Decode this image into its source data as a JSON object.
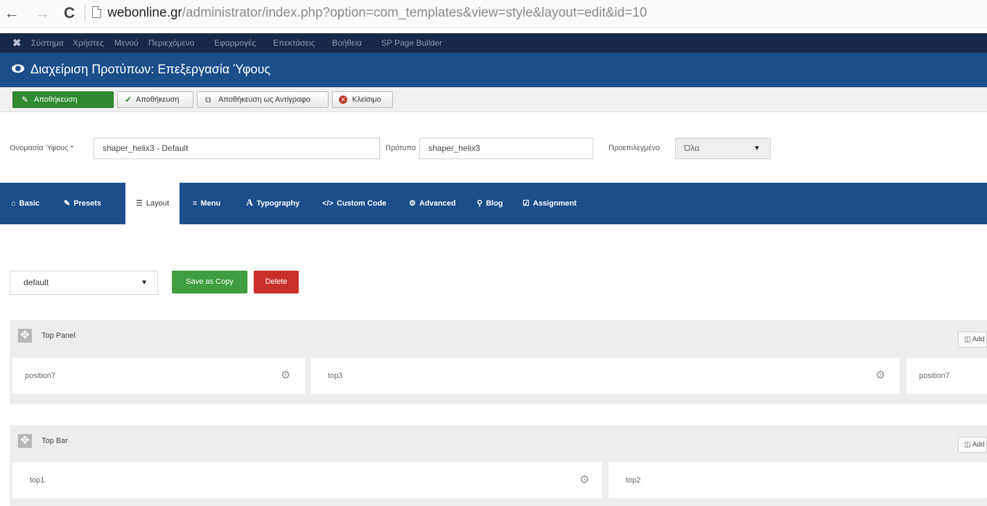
{
  "browser": {
    "back_glyph": "←",
    "forward_glyph": "→",
    "reload_glyph": "C",
    "url_host": "webonline.gr",
    "url_path": "/administrator/index.php?option=com_templates&view=style&layout=edit&id=10"
  },
  "admin_menu": {
    "logo_glyph": "✖",
    "items": [
      "Σύστημα",
      "Χρήστες",
      "Μενού",
      "Περιεχόμενο",
      "Εφαρμογές",
      "Επεκτάσεις",
      "Βοήθεια",
      "SP Page Builder"
    ]
  },
  "title_bar": {
    "title": "Διαχείριση Προτύπων: Επεξεργασία Ύφους"
  },
  "toolbar": {
    "save_primary": "Αποθήκευση",
    "save_primary_icon": "✎",
    "save": "Αποθήκευση",
    "save_icon": "✔",
    "save_copy": "Αποθήκευση ως Αντίγραφο",
    "save_copy_icon": "⧉",
    "close": "Κλείσιμο",
    "close_icon": "✕"
  },
  "form": {
    "style_name_label": "Ονομασία Ύφους *",
    "style_name_value": "shaper_helix3 - Default",
    "template_label": "Πρότυπο",
    "template_value": "shaper_helix3",
    "default_label": "Προεπιλεγμένο",
    "default_value": "Όλα",
    "caret": "▼"
  },
  "tabs": [
    {
      "label": "Basic",
      "icon": "⌂"
    },
    {
      "label": "Presets",
      "icon": "✎"
    },
    {
      "label": "Layout",
      "icon": "☰",
      "active": true
    },
    {
      "label": "Menu",
      "icon": "≡"
    },
    {
      "label": "Typography",
      "icon": "A"
    },
    {
      "label": "Custom Code",
      "icon": "</>"
    },
    {
      "label": "Advanced",
      "icon": "⚙"
    },
    {
      "label": "Blog",
      "icon": "⚲"
    },
    {
      "label": "Assignment",
      "icon": "☑"
    }
  ],
  "layout_controls": {
    "layout_select_value": "default",
    "caret": "▼",
    "save_as_copy": "Save as Copy",
    "delete": "Delete"
  },
  "sections": [
    {
      "title": "Top Panel",
      "add_label": "Add",
      "columns": [
        "position7",
        "top3",
        "position7"
      ]
    },
    {
      "title": "Top Bar",
      "add_label": "Add",
      "columns": [
        "top1",
        "top2"
      ]
    }
  ],
  "glyphs": {
    "move": "✥",
    "gear": "⚙",
    "columns": "◫"
  },
  "colors": {
    "admin_menu_bg": "#17284a",
    "title_bar_bg": "#1b4e8a",
    "save_green": "#2f8b30",
    "delete_red": "#c9302c"
  }
}
